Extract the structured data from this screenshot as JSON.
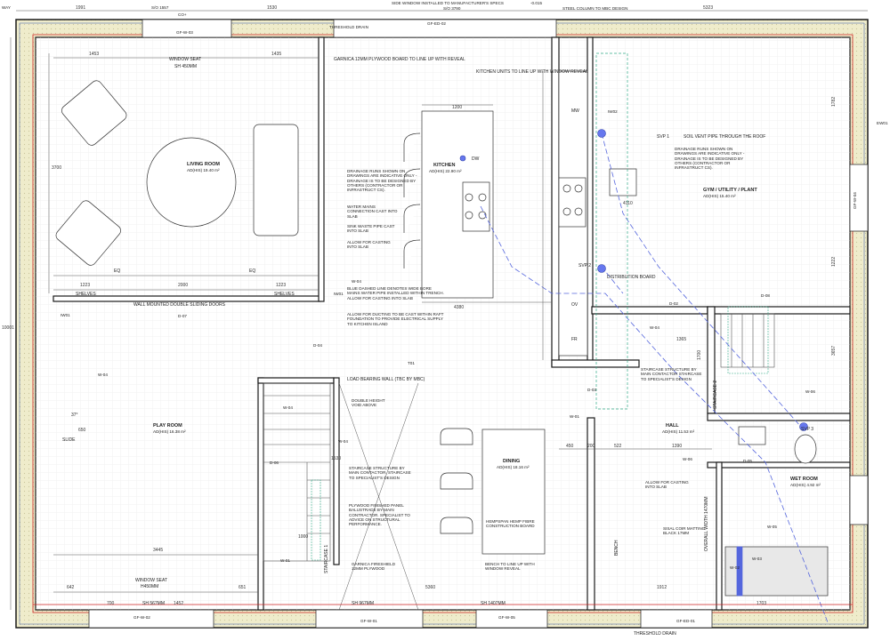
{
  "top_labels": {
    "side_window": "SIDE WINDOW INSTALLED TO MANUFACTURER'S SPECS",
    "steel_column": "STEEL COLUMN TO MBC DESIGN",
    "so_3790": "S/O 3790",
    "so_1557": "S/O 1557",
    "co_plus": "CO+",
    "level_neg": "-0.015",
    "way": "WAY",
    "threshold_drain": "THRESHOLD DRAIN",
    "threshold_drain_bottom": "THRESHOLD DRAIN"
  },
  "dims": {
    "d1991": "1991",
    "d1530": "1530",
    "d5323": "5323",
    "d1453": "1453",
    "d1435": "1435",
    "d1200": "1200",
    "d1223a": "1223",
    "d2000": "2000",
    "d1223b": "1223",
    "d4380": "4380",
    "d3700": "3700",
    "d10001": "10001",
    "d650a": "650",
    "d1365": "1365",
    "d1700": "1700",
    "d450": "450",
    "d200": "200",
    "d522": "522",
    "d1390": "1390",
    "d3445": "3445",
    "d642": "642",
    "d651": "651",
    "d5360": "5360",
    "d700": "700",
    "d1452": "1452",
    "d1703": "1703",
    "d1912": "1912",
    "d1222": "1222",
    "d3657": "3657",
    "d1782": "1782",
    "d1530b": "1530",
    "d1000": "1000",
    "d4110": "4110"
  },
  "rooms": [
    {
      "name": "LIVING ROOM",
      "code": "GF-R-03",
      "area": "AD(HIS) 19.40 m²",
      "vol": "V(45) 26.42 m³"
    },
    {
      "name": "KITCHEN",
      "code": "GF-R-06",
      "area": "AD(HIS) 22.90 m²",
      "vol": "V(45) 26.19 m³"
    },
    {
      "name": "GYM / UTILITY / PLANT",
      "code": "GF-R-04",
      "area": "AD(HIS) 15.40 m²",
      "vol": "V(45) 22.17 m³"
    },
    {
      "name": "PLAY ROOM",
      "code": "GF-R-02",
      "area": "AD(HIS) 16.38 m²",
      "vol": "V(45) 26.42 m³"
    },
    {
      "name": "DINING",
      "code": "GF-R-05",
      "area": "AD(HIS) 18.16 m²",
      "vol": "V(45) 28.73 m³"
    },
    {
      "name": "HALL",
      "code": "GF-R-01",
      "area": "AD(HIS) 11.53 m²",
      "vol": "V(45) 28.47 m³"
    },
    {
      "name": "WET ROOM",
      "code": "GF-R-07",
      "area": "AD(HIS) 4.92 m²",
      "vol": "V(45) 11.86 m³"
    }
  ],
  "notes": {
    "garnica": "GARNICA 12MM PLYWOOD  BOARD TO LINE UP WITH REVEAL",
    "kitchen_units": "KITCHEN UNITS TO LINE UP WITH WINDOW REVEAL",
    "window_seat": "WINDOW SEAT",
    "sh450": "SH 450MM",
    "svp1": "SVP 1",
    "soil_vent": "SOIL VENT PIPE THROUGH THE ROOF",
    "drainage_right": "DRAINAGE RUNS SHOWN ON DRAWINGS ARE INDICATIVE ONLY - DRAINAGE IS TO BE DESIGNED BY OTHERS (CONTRACTOR OR INFRASTRUCT CS).",
    "drainage_left": "DRAINAGE RUNS SHOWN ON DRAWINGS ARE INDICATIVE ONLY - DRAINAGE IS TO BE DESIGNED BY OTHERS (CONTRACTOR OR INFRASTRUCT CS).",
    "water_mains": "WATER MAINS CONNECTION CAST INTO SLAB",
    "sink_waste": "SINK WASTE PIPE CAST INTO SLAB",
    "allow_casting": "ALLOW FOR CASTING INTO SLAB",
    "svp2": "SVP 2",
    "dist_board": "DISTRIBUTION BOARD",
    "blue_dashed": "BLUE DASHED LINE DENOTES WIDE BORE MAINS WATER PIPE INSTALLED WITHIN TRENCH. ALLOW FOR CASTING INTO SLAB",
    "allow_ducting": "ALLOW FOR DUCTING TO BE CAST WITHIN RAFT FOUNDATION TO PROVIDE ELECTRICAL SUPPLY TO KITCHEN ISLAND",
    "wall_mounted": "WALL MOUNTED DOUBLE SLIDING DOORS",
    "shelves_a": "SHELVES",
    "shelves_b": "SHELVES",
    "eq_a": "EQ",
    "eq_b": "EQ",
    "load_bearing": "LOAD BEARING WALL (TBC BY MBC)",
    "double_height": "DOUBLE HEIGHT VOID ABOVE",
    "staircase_struct": "STAIRCASE STRUCTURE BY MAIN CONTACTOR, STAIRCASE TO SPECIALIST'S DESIGN",
    "staircase_struct_r": "STAIRCASE STRUCTURE BY MAIN CONTACTOR STAIRCASE TO SPECIALIST'S DESIGN",
    "plywood_panel": "PLYWOOD FINISHED PANEL BALUSTRADE BY MAIN CONTRACTOR.  SPECIALIST TO ADVICE ON STRUCTURAL PERFORMANCE.",
    "hempspan": "HEMPSPAN HEMP FIBRE CONSTRUCTION BOARD",
    "garnica_fireshield": "GARNICA FIRESHIELD 12MM PLYWOOD",
    "bench_line": "BENCH TO LINE UP WITH WINDOW REVEAL",
    "window_seat_b": "WINDOW SEAT",
    "h450": "H450MM",
    "sisal": "SISAL COIR MATTING BLACK 17MM",
    "allow_casting_2": "ALLOW FOR CASTING INTO SLAB",
    "overall_width": "OVERALL WIDTH 1470MM",
    "bench": "BENCH",
    "staircase1": "STAIRCASE 1",
    "staircase2": "STAIRCASE 2",
    "slide": "SLIDE",
    "svp3": "SVP 3",
    "sh567": "SH 567MM",
    "sh1407": "SH 1407MM",
    "sh967": "SH 967MM",
    "threshold_r": "THRESHOLD DRAIN",
    "mw": "MW",
    "ov": "OV",
    "fr": "FR",
    "dw": "DW",
    "angle37": "37°"
  },
  "tags": {
    "gfw03": "GF-W-03",
    "gfed02": "GF-ED-02",
    "gfw02": "GF-W-02",
    "gfw01": "GF-W-01",
    "gfw05": "GF-W-05",
    "gfed01": "GF-ED-01",
    "iw01": "IW01",
    "iw02": "IW02",
    "d07": "D-07",
    "d04": "D-04",
    "d06": "D-06",
    "d08": "D-08",
    "d03": "D-03",
    "d02": "D-02",
    "d05": "D-05",
    "d01": "D-01",
    "t01": "T01",
    "w01": "W-01",
    "w04": "W-04",
    "w05": "W-05",
    "w06": "W-06",
    "w03": "W-03",
    "w02": "W-02",
    "ew01": "EW01",
    "gfw04": "GF-W-04"
  },
  "colors": {
    "insulation": "#efeccb",
    "blue_pipe": "#5566dd",
    "green_dash": "#33aa88",
    "red_line": "#cc2222",
    "wall": "#1a1a1a"
  }
}
